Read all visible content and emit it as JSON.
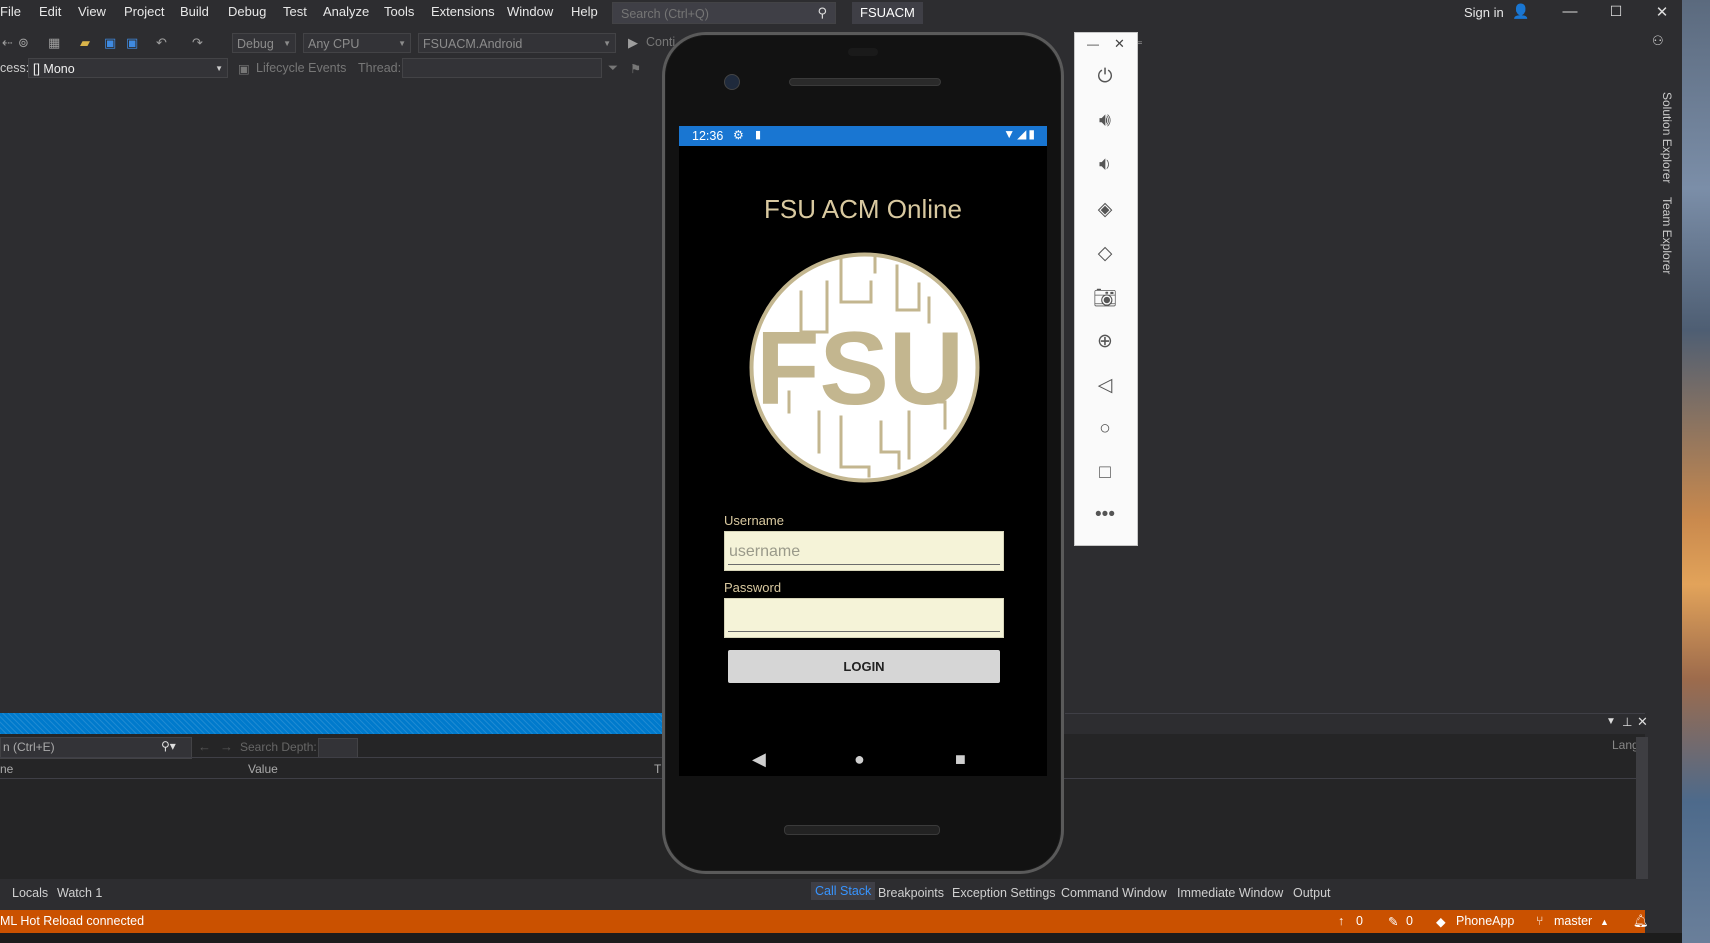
{
  "menu": {
    "items": [
      "File",
      "Edit",
      "View",
      "Project",
      "Build",
      "Debug",
      "Test",
      "Analyze",
      "Tools",
      "Extensions",
      "Window",
      "Help"
    ],
    "search_placeholder": "Search (Ctrl+Q)",
    "solution_name": "FSUACM",
    "sign_in": "Sign in"
  },
  "toolbar": {
    "config": "Debug",
    "platform": "Any CPU",
    "startup_project": "FSUACM.Android",
    "continue_label": "Conti"
  },
  "debug_location": {
    "process_label": "cess:",
    "process_value": "[] Mono",
    "lifecycle_label": "Lifecycle Events",
    "thread_label": "Thread:"
  },
  "right_tabs": [
    "Solution Explorer",
    "Team Explorer"
  ],
  "autos": {
    "search_placeholder": "n (Ctrl+E)",
    "search_depth_label": "Search Depth:",
    "columns": [
      "ne",
      "Value",
      "T"
    ],
    "right_column": "Lang"
  },
  "bottom_tabs_left": [
    "Locals",
    "Watch 1"
  ],
  "bottom_tabs_right": [
    "Call Stack",
    "Breakpoints",
    "Exception Settings",
    "Command Window",
    "Immediate Window",
    "Output"
  ],
  "status": {
    "message": "ML Hot Reload connected",
    "up_count": "0",
    "edit_count": "0",
    "project": "PhoneApp",
    "branch": "master"
  },
  "phone": {
    "time": "12:36",
    "app_title": "FSU ACM Online",
    "logo_text": "FSU",
    "username_label": "Username",
    "username_placeholder": "username",
    "password_label": "Password",
    "login_button": "LOGIN"
  },
  "emulator_controls": [
    "power",
    "volume-up",
    "volume-down",
    "rotate-left",
    "rotate-right",
    "screenshot",
    "zoom",
    "back",
    "home",
    "overview",
    "more"
  ],
  "colors": {
    "accent": "#007acc",
    "status_bar": "#ca5100",
    "phone_status": "#1976d2",
    "gold": "#d9c9a0",
    "field_bg": "#f5f3d8"
  }
}
